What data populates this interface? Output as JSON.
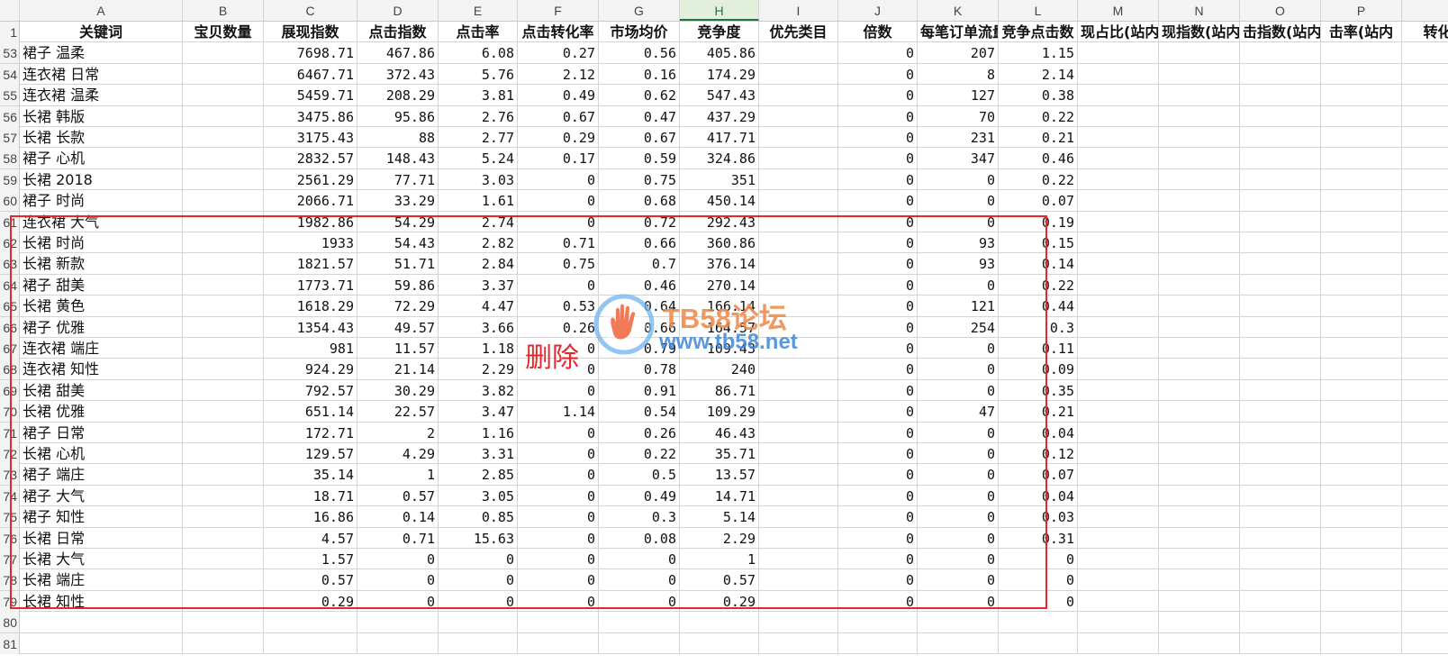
{
  "sheet": {
    "columns": [
      "A",
      "B",
      "C",
      "D",
      "E",
      "F",
      "G",
      "H",
      "I",
      "J",
      "K",
      "L",
      "M",
      "N",
      "O",
      "P",
      ""
    ],
    "selected_column": "H",
    "header_row": {
      "row_label": "1",
      "cells": [
        "关键词",
        "宝贝数量",
        "展现指数",
        "点击指数",
        "点击率",
        "点击转化率",
        "市场均价",
        "竞争度",
        "优先类目",
        "倍数",
        "每笔订单流量",
        "竞争点击数",
        "现占比(站内",
        "现指数(站内",
        "击指数(站内",
        "击率(站内",
        "转化"
      ]
    },
    "rows": [
      {
        "n": "53",
        "kw": "裙子 温柔",
        "c": "7698.71",
        "d": "467.86",
        "e": "6.08",
        "f": "0.27",
        "g": "0.56",
        "h": "405.86",
        "j": "0",
        "k": "207",
        "l": "1.15"
      },
      {
        "n": "54",
        "kw": "连衣裙 日常",
        "c": "6467.71",
        "d": "372.43",
        "e": "5.76",
        "f": "2.12",
        "g": "0.16",
        "h": "174.29",
        "j": "0",
        "k": "8",
        "l": "2.14"
      },
      {
        "n": "55",
        "kw": "连衣裙 温柔",
        "c": "5459.71",
        "d": "208.29",
        "e": "3.81",
        "f": "0.49",
        "g": "0.62",
        "h": "547.43",
        "j": "0",
        "k": "127",
        "l": "0.38"
      },
      {
        "n": "56",
        "kw": "长裙 韩版",
        "c": "3475.86",
        "d": "95.86",
        "e": "2.76",
        "f": "0.67",
        "g": "0.47",
        "h": "437.29",
        "j": "0",
        "k": "70",
        "l": "0.22"
      },
      {
        "n": "57",
        "kw": "长裙 长款",
        "c": "3175.43",
        "d": "88",
        "e": "2.77",
        "f": "0.29",
        "g": "0.67",
        "h": "417.71",
        "j": "0",
        "k": "231",
        "l": "0.21"
      },
      {
        "n": "58",
        "kw": "裙子 心机",
        "c": "2832.57",
        "d": "148.43",
        "e": "5.24",
        "f": "0.17",
        "g": "0.59",
        "h": "324.86",
        "j": "0",
        "k": "347",
        "l": "0.46"
      },
      {
        "n": "59",
        "kw": "长裙 2018",
        "c": "2561.29",
        "d": "77.71",
        "e": "3.03",
        "f": "0",
        "g": "0.75",
        "h": "351",
        "j": "0",
        "k": "0",
        "l": "0.22"
      },
      {
        "n": "60",
        "kw": "裙子 时尚",
        "c": "2066.71",
        "d": "33.29",
        "e": "1.61",
        "f": "0",
        "g": "0.68",
        "h": "450.14",
        "j": "0",
        "k": "0",
        "l": "0.07"
      },
      {
        "n": "61",
        "kw": "连衣裙 大气",
        "c": "1982.86",
        "d": "54.29",
        "e": "2.74",
        "f": "0",
        "g": "0.72",
        "h": "292.43",
        "j": "0",
        "k": "0",
        "l": "0.19"
      },
      {
        "n": "62",
        "kw": "长裙 时尚",
        "c": "1933",
        "d": "54.43",
        "e": "2.82",
        "f": "0.71",
        "g": "0.66",
        "h": "360.86",
        "j": "0",
        "k": "93",
        "l": "0.15"
      },
      {
        "n": "63",
        "kw": "长裙 新款",
        "c": "1821.57",
        "d": "51.71",
        "e": "2.84",
        "f": "0.75",
        "g": "0.7",
        "h": "376.14",
        "j": "0",
        "k": "93",
        "l": "0.14"
      },
      {
        "n": "64",
        "kw": "裙子 甜美",
        "c": "1773.71",
        "d": "59.86",
        "e": "3.37",
        "f": "0",
        "g": "0.46",
        "h": "270.14",
        "j": "0",
        "k": "0",
        "l": "0.22"
      },
      {
        "n": "65",
        "kw": "长裙 黄色",
        "c": "1618.29",
        "d": "72.29",
        "e": "4.47",
        "f": "0.53",
        "g": "0.64",
        "h": "166.14",
        "j": "0",
        "k": "121",
        "l": "0.44"
      },
      {
        "n": "66",
        "kw": "裙子 优雅",
        "c": "1354.43",
        "d": "49.57",
        "e": "3.66",
        "f": "0.26",
        "g": "0.66",
        "h": "164.57",
        "j": "0",
        "k": "254",
        "l": "0.3"
      },
      {
        "n": "67",
        "kw": "连衣裙 端庄",
        "c": "981",
        "d": "11.57",
        "e": "1.18",
        "f": "0",
        "g": "0.79",
        "h": "109.43",
        "j": "0",
        "k": "0",
        "l": "0.11"
      },
      {
        "n": "68",
        "kw": "连衣裙 知性",
        "c": "924.29",
        "d": "21.14",
        "e": "2.29",
        "f": "0",
        "g": "0.78",
        "h": "240",
        "j": "0",
        "k": "0",
        "l": "0.09"
      },
      {
        "n": "69",
        "kw": "长裙 甜美",
        "c": "792.57",
        "d": "30.29",
        "e": "3.82",
        "f": "0",
        "g": "0.91",
        "h": "86.71",
        "j": "0",
        "k": "0",
        "l": "0.35"
      },
      {
        "n": "70",
        "kw": "长裙 优雅",
        "c": "651.14",
        "d": "22.57",
        "e": "3.47",
        "f": "1.14",
        "g": "0.54",
        "h": "109.29",
        "j": "0",
        "k": "47",
        "l": "0.21"
      },
      {
        "n": "71",
        "kw": "裙子 日常",
        "c": "172.71",
        "d": "2",
        "e": "1.16",
        "f": "0",
        "g": "0.26",
        "h": "46.43",
        "j": "0",
        "k": "0",
        "l": "0.04"
      },
      {
        "n": "72",
        "kw": "长裙 心机",
        "c": "129.57",
        "d": "4.29",
        "e": "3.31",
        "f": "0",
        "g": "0.22",
        "h": "35.71",
        "j": "0",
        "k": "0",
        "l": "0.12"
      },
      {
        "n": "73",
        "kw": "裙子 端庄",
        "c": "35.14",
        "d": "1",
        "e": "2.85",
        "f": "0",
        "g": "0.5",
        "h": "13.57",
        "j": "0",
        "k": "0",
        "l": "0.07"
      },
      {
        "n": "74",
        "kw": "裙子 大气",
        "c": "18.71",
        "d": "0.57",
        "e": "3.05",
        "f": "0",
        "g": "0.49",
        "h": "14.71",
        "j": "0",
        "k": "0",
        "l": "0.04"
      },
      {
        "n": "75",
        "kw": "裙子 知性",
        "c": "16.86",
        "d": "0.14",
        "e": "0.85",
        "f": "0",
        "g": "0.3",
        "h": "5.14",
        "j": "0",
        "k": "0",
        "l": "0.03"
      },
      {
        "n": "76",
        "kw": "长裙 日常",
        "c": "4.57",
        "d": "0.71",
        "e": "15.63",
        "f": "0",
        "g": "0.08",
        "h": "2.29",
        "j": "0",
        "k": "0",
        "l": "0.31"
      },
      {
        "n": "77",
        "kw": "长裙 大气",
        "c": "1.57",
        "d": "0",
        "e": "0",
        "f": "0",
        "g": "0",
        "h": "1",
        "j": "0",
        "k": "0",
        "l": "0"
      },
      {
        "n": "78",
        "kw": "长裙 端庄",
        "c": "0.57",
        "d": "0",
        "e": "0",
        "f": "0",
        "g": "0",
        "h": "0.57",
        "j": "0",
        "k": "0",
        "l": "0"
      },
      {
        "n": "79",
        "kw": "长裙 知性",
        "c": "0.29",
        "d": "0",
        "e": "0",
        "f": "0",
        "g": "0",
        "h": "0.29",
        "j": "0",
        "k": "0",
        "l": "0"
      },
      {
        "n": "80"
      },
      {
        "n": "81"
      }
    ]
  },
  "annotation": {
    "label": "删除",
    "color": "#e8262b"
  },
  "watermark": {
    "title": "TB58论坛",
    "url": "www.tb58.net",
    "icon": "hand-logo-icon"
  },
  "colors": {
    "grid": "#d4d4d4",
    "header_bg": "#f3f3f3",
    "selected_col_accent": "#217346"
  }
}
